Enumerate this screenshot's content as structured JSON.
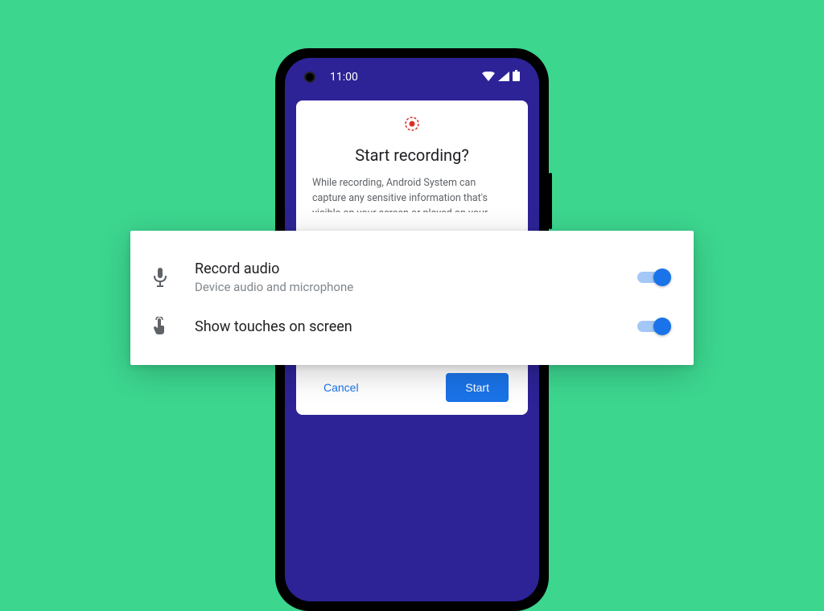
{
  "status": {
    "time": "11:00"
  },
  "dialog": {
    "title": "Start recording?",
    "body": "While recording, Android System can capture any sensitive information that's visible on your screen or played on your device. This includes passwords, payment",
    "cancel_label": "Cancel",
    "start_label": "Start"
  },
  "options": {
    "record_audio": {
      "title": "Record audio",
      "subtitle": "Device audio and microphone",
      "enabled": true
    },
    "show_touches": {
      "title": "Show touches on screen",
      "enabled": true
    }
  }
}
